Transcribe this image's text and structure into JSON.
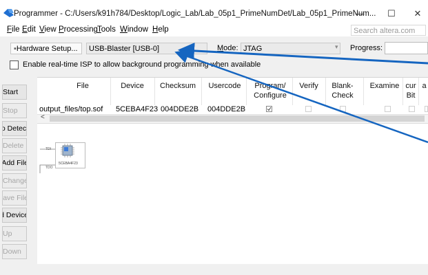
{
  "window": {
    "title": "Programmer - C:/Users/k91h784/Desktop/Logic_Lab/Lab_05p1_PrimeNumDet/Lab_05p1_PrimeNum...",
    "minimize": "—",
    "maximize": "☐",
    "close": "✕"
  },
  "menu": {
    "items": [
      {
        "underline": "F",
        "rest": "ile"
      },
      {
        "underline": "E",
        "rest": "dit"
      },
      {
        "underline": "V",
        "rest": "iew"
      },
      {
        "underline": "P",
        "rest": "rocessing"
      },
      {
        "underline": "T",
        "rest": "ools"
      },
      {
        "underline": "W",
        "rest": "indow"
      },
      {
        "underline": "H",
        "rest": "elp"
      }
    ],
    "search_placeholder": "Search altera.com"
  },
  "toolbar": {
    "hardware_setup_label": "Hardware Setup...",
    "hardware_value": "USB-Blaster [USB-0]",
    "mode_label": "Mode:",
    "mode_value": "JTAG",
    "progress_label": "Progress:"
  },
  "isp": {
    "label": "Enable real-time ISP to allow background programming when available",
    "checked": false
  },
  "side_buttons": [
    {
      "label": "Start",
      "enabled": true
    },
    {
      "label": "Stop",
      "enabled": false
    },
    {
      "label": "Auto Detect",
      "enabled": true
    },
    {
      "label": "Delete",
      "enabled": false
    },
    {
      "label": "Add File",
      "enabled": true
    },
    {
      "label": "Change",
      "enabled": false
    },
    {
      "label": "Save File",
      "enabled": false
    },
    {
      "label": "Add Device",
      "enabled": true
    },
    {
      "label": "Up",
      "enabled": false
    },
    {
      "label": "Down",
      "enabled": false
    }
  ],
  "table": {
    "headers": {
      "file": "File",
      "device": "Device",
      "checksum": "Checksum",
      "usercode": "Usercode",
      "program_1": "Program/",
      "program_2": "Configure",
      "verify": "Verify",
      "blank_1": "Blank-",
      "blank_2": "Check",
      "examine": "Examine",
      "sec_1": "cur",
      "sec_2": "Bit",
      "erase": "a"
    },
    "rows": [
      {
        "file": "output_files/top.sof",
        "device": "5CEBA4F23",
        "checksum": "004DDE2B",
        "usercode": "004DDE2B",
        "program": true,
        "verify": false,
        "blank_check": false,
        "examine": false
      }
    ],
    "scroll_left": "<"
  },
  "diagram": {
    "tdi": "TDI",
    "tdo": "TDO",
    "device_caption": "5CEBA4F23"
  },
  "colors": {
    "accent_blue": "#1f6fd1",
    "arrow_blue": "#1565c0"
  }
}
